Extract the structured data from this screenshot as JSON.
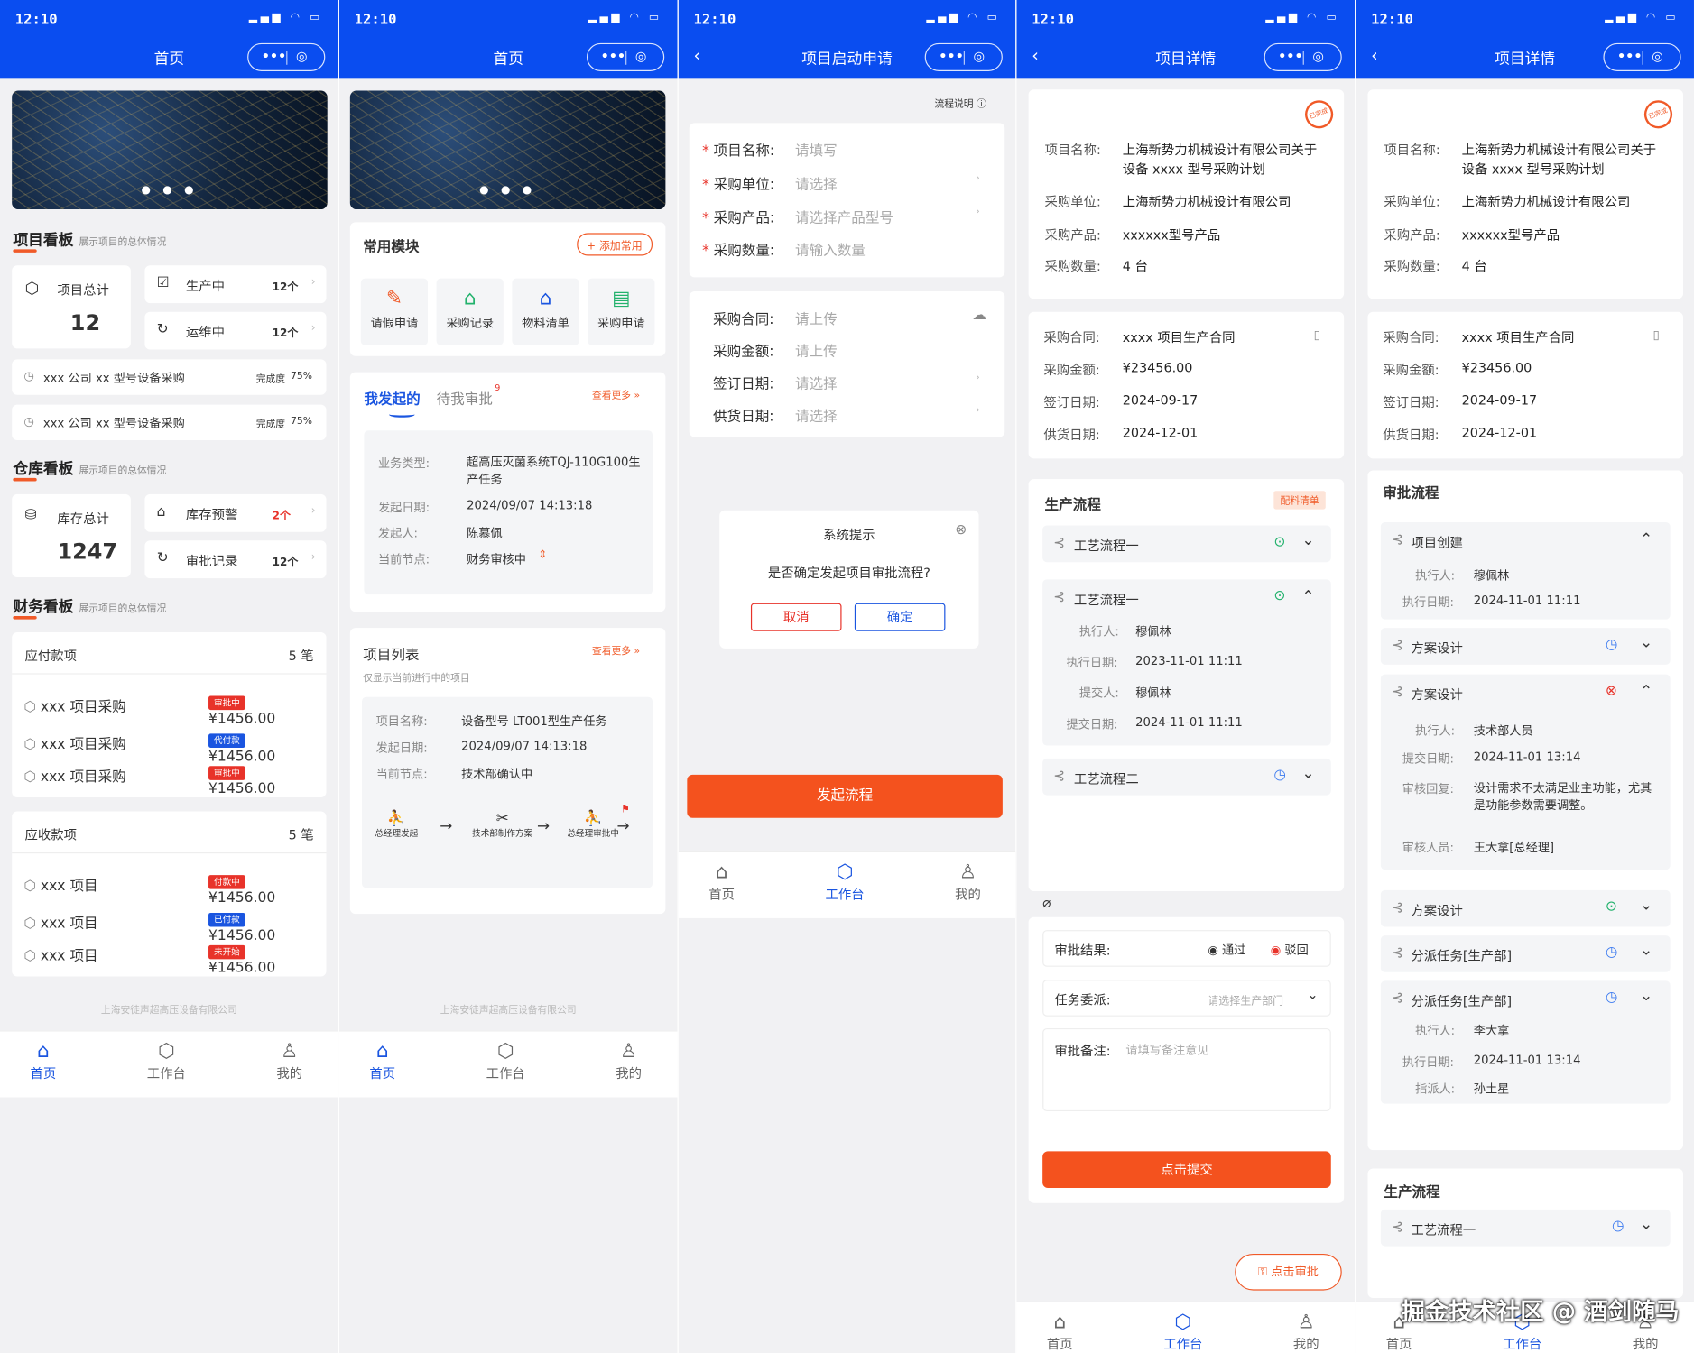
{
  "status": {
    "time": "12:10",
    "icons": "▂▄▆ ◠ ▭"
  },
  "capsule": {
    "more": "•••",
    "target": "◎"
  },
  "icons": {
    "back": "‹",
    "chevron": "›",
    "chevron_down": "⌄",
    "chevron_up": "⌃",
    "close": "⊗",
    "clock": "◷",
    "check": "✓",
    "cross": "✕",
    "box": "⬡",
    "clip": "🔗"
  },
  "s1": {
    "nav_title": "首页",
    "project_board": {
      "title": "项目看板",
      "sub": "展示项目的总体情况",
      "total_label": "项目总计",
      "total_value": "12",
      "items": [
        {
          "label": "生产中",
          "value": "12个"
        },
        {
          "label": "运维中",
          "value": "12个"
        }
      ],
      "rows": [
        {
          "name": "xxx 公司 xx 型号设备采购",
          "progress_label": "完成度",
          "progress": "75%"
        },
        {
          "name": "xxx 公司 xx 型号设备采购",
          "progress_label": "完成度",
          "progress": "75%"
        }
      ]
    },
    "warehouse_board": {
      "title": "仓库看板",
      "sub": "展示项目的总体情况",
      "total_label": "库存总计",
      "total_value": "1247",
      "items": [
        {
          "label": "库存预警",
          "value": "2个"
        },
        {
          "label": "审批记录",
          "value": "12个"
        }
      ]
    },
    "finance_board": {
      "title": "财务看板",
      "sub": "展示项目的总体情况",
      "payable": {
        "title": "应付款项",
        "count": "5 笔",
        "rows": [
          {
            "name": "xxx 项目采购",
            "badge": "审批中",
            "amount": "¥1456.00"
          },
          {
            "name": "xxx 项目采购",
            "badge": "代付款",
            "amount": "¥1456.00"
          },
          {
            "name": "xxx 项目采购",
            "badge": "审批中",
            "amount": "¥1456.00"
          }
        ]
      },
      "receivable": {
        "title": "应收款项",
        "count": "5 笔",
        "rows": [
          {
            "name": "xxx 项目",
            "badge": "付款中",
            "amount": "¥1456.00"
          },
          {
            "name": "xxx 项目",
            "badge": "已付款",
            "amount": "¥1456.00"
          },
          {
            "name": "xxx 项目",
            "badge": "未开始",
            "amount": "¥1456.00"
          }
        ]
      }
    },
    "footer": "上海安徒声超高压设备有限公司"
  },
  "s2": {
    "nav_title": "首页",
    "modules": {
      "title": "常用模块",
      "add_label": "+ 添加常用",
      "items": [
        {
          "label": "请假申请"
        },
        {
          "label": "采购记录"
        },
        {
          "label": "物料清单"
        },
        {
          "label": "采购申请"
        }
      ]
    },
    "tabs": {
      "active": "我发起的",
      "other": "待我审批",
      "other_badge": "9",
      "more": "查看更多 »"
    },
    "task": {
      "rows": [
        {
          "label": "业务类型:",
          "value": "超高压灭菌系统TQJ-110G100生产任务"
        },
        {
          "label": "发起日期:",
          "value": "2024/09/07 14:13:18"
        },
        {
          "label": "发起人:",
          "value": "陈慕佩"
        },
        {
          "label": "当前节点:",
          "value": "财务审核中"
        }
      ]
    },
    "project_list": {
      "title": "项目列表",
      "more": "查看更多 »",
      "sub": "仅显示当前进行中的项目",
      "rows": [
        {
          "label": "项目名称:",
          "value": "设备型号 LT001型生产任务"
        },
        {
          "label": "发起日期:",
          "value": "2024/09/07 14:13:18"
        },
        {
          "label": "当前节点:",
          "value": "技术部确认中"
        }
      ],
      "flow": [
        {
          "label": "总经理发起"
        },
        {
          "label": "技术部制作方案"
        },
        {
          "label": "总经理审批中"
        }
      ]
    },
    "footer": "上海安徒声超高压设备有限公司"
  },
  "s3": {
    "nav_title": "项目启动申请",
    "help": "流程说明 ⓘ",
    "form1": [
      {
        "label": "项目名称:",
        "ph": "请填写"
      },
      {
        "label": "采购单位:",
        "ph": "请选择"
      },
      {
        "label": "采购产品:",
        "ph": "请选择产品型号"
      },
      {
        "label": "采购数量:",
        "ph": "请输入数量"
      }
    ],
    "form2": [
      {
        "label": "采购合同:",
        "ph": "请上传"
      },
      {
        "label": "采购金额:",
        "ph": "请上传"
      },
      {
        "label": "签订日期:",
        "ph": "请选择"
      },
      {
        "label": "供货日期:",
        "ph": "请选择"
      }
    ],
    "dialog": {
      "title": "系统提示",
      "message": "是否确定发起项目审批流程?",
      "cancel": "取消",
      "confirm": "确定"
    },
    "submit": "发起流程"
  },
  "s4": {
    "nav_title": "项目详情",
    "seal": "已完成",
    "info": [
      {
        "label": "项目名称:",
        "value": "上海新势力机械设计有限公司关于设备 xxxx 型号采购计划"
      },
      {
        "label": "采购单位:",
        "value": "上海新势力机械设计有限公司"
      },
      {
        "label": "采购产品:",
        "value": "xxxxxx型号产品"
      },
      {
        "label": "采购数量:",
        "value": "4 台"
      }
    ],
    "contract": [
      {
        "label": "采购合同:",
        "value": "xxxx 项目生产合同"
      },
      {
        "label": "采购金额:",
        "value": "¥23456.00"
      },
      {
        "label": "签订日期:",
        "value": "2024-09-17"
      },
      {
        "label": "供货日期:",
        "value": "2024-12-01"
      }
    ],
    "process": {
      "title": "生产流程",
      "tag": "配料清单",
      "steps": [
        {
          "name": "工艺流程一"
        },
        {
          "name": "工艺流程一",
          "details": [
            {
              "label": "执行人:",
              "value": "穆佩林"
            },
            {
              "label": "执行日期:",
              "value": "2023-11-01 11:11"
            },
            {
              "label": "提交人:",
              "value": "穆佩林"
            },
            {
              "label": "提交日期:",
              "value": "2024-11-01 11:11"
            }
          ]
        },
        {
          "name": "工艺流程二"
        }
      ]
    },
    "approval": {
      "result_label": "审批结果:",
      "pass": "通过",
      "reject": "驳回",
      "assign_label": "任务委派:",
      "assign_ph": "请选择生产部门",
      "note_label": "审批备注:",
      "note_ph": "请填写备注意见",
      "submit": "点击提交"
    },
    "float_btn": "点击审批"
  },
  "s5": {
    "nav_title": "项目详情",
    "approval_flow": {
      "title": "审批流程",
      "steps": [
        {
          "name": "项目创建",
          "details": [
            {
              "label": "执行人:",
              "value": "穆佩林"
            },
            {
              "label": "执行日期:",
              "value": "2024-11-01 11:11"
            }
          ]
        },
        {
          "name": "方案设计"
        },
        {
          "name": "方案设计",
          "details": [
            {
              "label": "执行人:",
              "value": "技术部人员"
            },
            {
              "label": "提交日期:",
              "value": "2024-11-01 13:14"
            },
            {
              "label": "审核回复:",
              "value": "设计需求不太满足业主功能，尤其是功能参数需要调整。"
            },
            {
              "label": "审核人员:",
              "value": "王大拿[总经理]"
            }
          ]
        },
        {
          "name": "方案设计"
        },
        {
          "name": "分派任务[生产部]"
        },
        {
          "name": "分派任务[生产部]",
          "details": [
            {
              "label": "执行人:",
              "value": "李大拿"
            },
            {
              "label": "执行日期:",
              "value": "2024-11-01 13:14"
            },
            {
              "label": "指派人:",
              "value": "孙土星"
            }
          ]
        }
      ]
    },
    "production": {
      "title": "生产流程",
      "step": "工艺流程一"
    }
  },
  "tabbar": {
    "home": "首页",
    "work": "工作台",
    "me": "我的",
    "home_icon": "⌂",
    "work_icon": "⬡",
    "me_icon": "♙"
  },
  "watermark": "掘金技术社区 @ 酒剑随马",
  "colors": {
    "brand": "#0a4df0",
    "accent": "#f4521e",
    "success": "#23b26d",
    "danger": "#e8332a"
  }
}
